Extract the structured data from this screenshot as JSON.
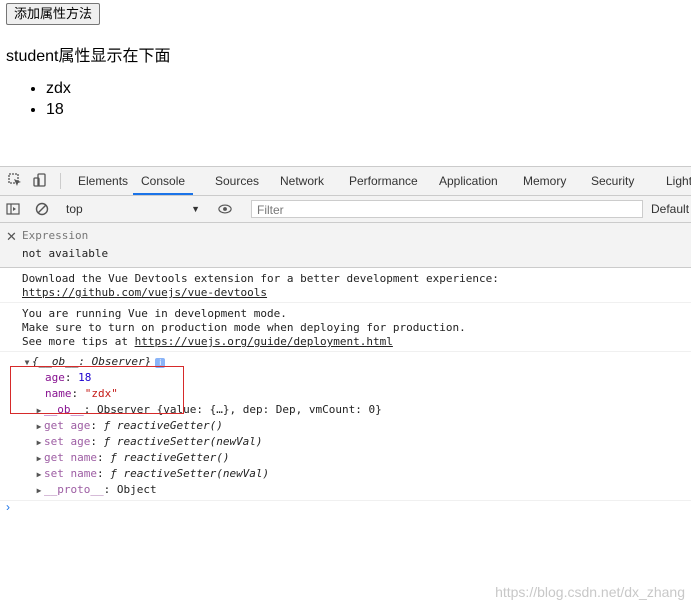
{
  "page": {
    "button_label": "添加属性方法",
    "heading": "student属性显示在下面",
    "list": [
      "zdx",
      "18"
    ]
  },
  "devtools": {
    "tabs": [
      "Elements",
      "Console",
      "Sources",
      "Network",
      "Performance",
      "Application",
      "Memory",
      "Security",
      "Light"
    ],
    "active_tab": "Console",
    "context": "top",
    "filter_placeholder": "Filter",
    "default_levels": "Default",
    "watch": {
      "label": "Expression",
      "value": "not available"
    },
    "messages": [
      {
        "line1": "Download the Vue Devtools extension for a better development experience:",
        "link": "https://github.com/vuejs/vue-devtools"
      },
      {
        "line1": "You are running Vue in development mode.",
        "line2": "Make sure to turn on production mode when deploying for production.",
        "line3_prefix": "See more tips at ",
        "link": "https://vuejs.org/guide/deployment.html"
      }
    ],
    "object": {
      "summary": "{__ob__: Observer}",
      "age_key": "age",
      "age_value": "18",
      "name_key": "name",
      "name_value": "\"zdx\"",
      "ob_key": "__ob__",
      "ob_value": "Observer {value: {…}, dep: Dep, vmCount: 0}",
      "get_age_key": "get age",
      "set_age_key": "set age",
      "get_name_key": "get name",
      "set_name_key": "set name",
      "getter": "ƒ reactiveGetter()",
      "setter": "ƒ reactiveSetter(newVal)",
      "proto_key": "__proto__",
      "proto_value": "Object"
    },
    "prompt": "›"
  },
  "watermark": "https://blog.csdn.net/dx_zhang",
  "colors": {
    "accent": "#1a73e8",
    "highlight_box": "#d62a2a"
  }
}
